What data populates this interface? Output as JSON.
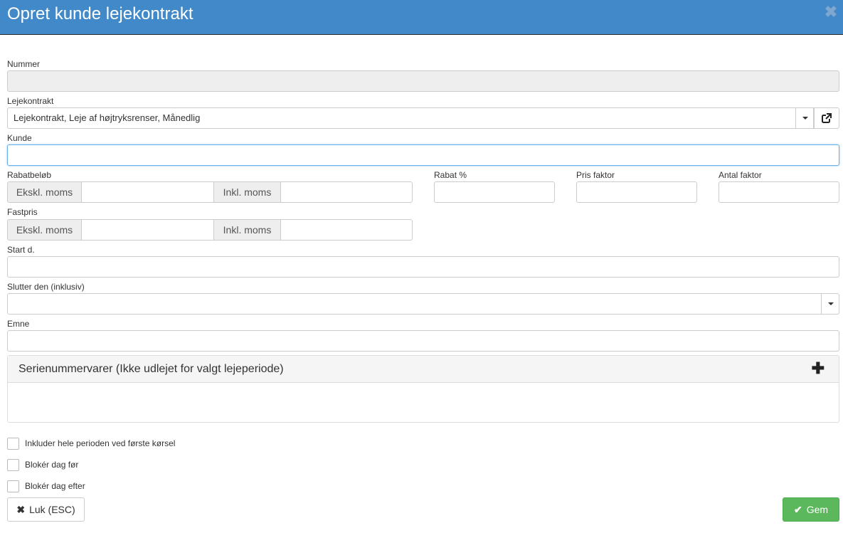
{
  "dialog": {
    "title": "Opret kunde lejekontrakt",
    "close_icon": "close-icon"
  },
  "form": {
    "nummer": {
      "label": "Nummer",
      "value": ""
    },
    "lejekontrakt": {
      "label": "Lejekontrakt",
      "value": "Lejekontrakt, Leje af højtryksrenser, Månedlig"
    },
    "kunde": {
      "label": "Kunde",
      "value": ""
    },
    "rabatbeloeb": {
      "label": "Rabatbeløb",
      "excl_label": "Ekskl. moms",
      "incl_label": "Inkl. moms",
      "excl_value": "",
      "incl_value": ""
    },
    "rabat_pct": {
      "label": "Rabat %",
      "value": ""
    },
    "pris_faktor": {
      "label": "Pris faktor",
      "value": ""
    },
    "antal_faktor": {
      "label": "Antal faktor",
      "value": ""
    },
    "fastpris": {
      "label": "Fastpris",
      "excl_label": "Ekskl. moms",
      "incl_label": "Inkl. moms",
      "excl_value": "",
      "incl_value": ""
    },
    "start": {
      "label": "Start d.",
      "value": ""
    },
    "slutter": {
      "label": "Slutter den (inklusiv)",
      "value": ""
    },
    "emne": {
      "label": "Emne",
      "value": ""
    }
  },
  "panel": {
    "title": "Serienummervarer (Ikke udlejet for valgt lejeperiode)",
    "add_icon": "plus-icon"
  },
  "checkboxes": [
    {
      "label": "Inkluder hele perioden ved første kørsel",
      "checked": false
    },
    {
      "label": "Blokér dag før",
      "checked": false
    },
    {
      "label": "Blokér dag efter",
      "checked": false
    }
  ],
  "buttons": {
    "close_label": "Luk (ESC)",
    "save_label": "Gem"
  },
  "colors": {
    "header": "#4189c8",
    "save": "#5cb85c",
    "focus": "#66afe9"
  }
}
